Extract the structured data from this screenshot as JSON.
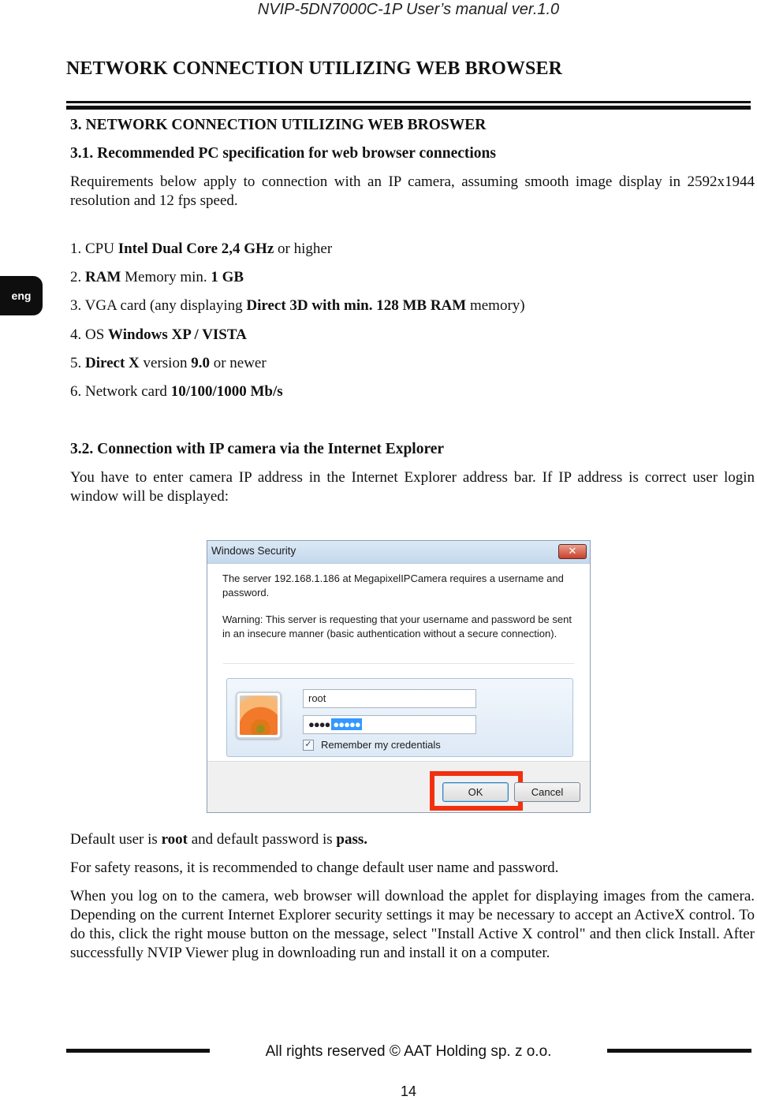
{
  "running_header": "NVIP-5DN7000C-1P User’s manual ver.1.0",
  "chapter_title": "NETWORK CONNECTION UTILIZING WEB BROWSER",
  "language_tab": "eng",
  "section3": {
    "heading": "3. NETWORK CONNECTION UTILIZING WEB BROSWER",
    "sub1": {
      "heading": "3.1. Recommended PC specification for web browser connections",
      "intro": "Requirements below apply to connection with an IP camera, assuming smooth image display in  2592x1944 resolution and 12 fps speed.",
      "requirements": [
        {
          "num": "1.",
          "parts": [
            {
              "t": " CPU ",
              "b": false
            },
            {
              "t": "Intel Dual Core 2,4 GHz",
              "b": true
            },
            {
              "t": " or higher",
              "b": false
            }
          ]
        },
        {
          "num": "2.",
          "parts": [
            {
              "t": " ",
              "b": false
            },
            {
              "t": "RAM",
              "b": true
            },
            {
              "t": " Memory min. ",
              "b": false
            },
            {
              "t": "1 GB",
              "b": true
            }
          ]
        },
        {
          "num": "3.",
          "parts": [
            {
              "t": " VGA card (any displaying ",
              "b": false
            },
            {
              "t": "Direct 3D with min. 128 MB RAM",
              "b": true
            },
            {
              "t": " memory)",
              "b": false
            }
          ]
        },
        {
          "num": "4.",
          "parts": [
            {
              "t": " OS ",
              "b": false
            },
            {
              "t": "Windows XP / VISTA",
              "b": true
            }
          ]
        },
        {
          "num": "5.",
          "parts": [
            {
              "t": " ",
              "b": false
            },
            {
              "t": "Direct X",
              "b": true
            },
            {
              "t": " version ",
              "b": false
            },
            {
              "t": "9.0",
              "b": true
            },
            {
              "t": " or newer",
              "b": false
            }
          ]
        },
        {
          "num": "6.",
          "parts": [
            {
              "t": " Network card ",
              "b": false
            },
            {
              "t": "10/100/1000 Mb/s",
              "b": true
            }
          ]
        }
      ]
    },
    "sub2": {
      "heading": "3.2. Connection with IP camera via the Internet Explorer",
      "intro": "You have to enter camera IP address in the Internet Explorer address bar. If IP address is correct user login window will be displayed:",
      "defaults": {
        "p1": "Default user is ",
        "user": "root",
        "p2": " and default password is ",
        "password": "pass."
      },
      "safety_note": "For safety reasons, it is recommended to change default user name and password.",
      "activex_note": "When you log on to the camera, web browser will download the applet for displaying images from the camera. Depending on the current Internet Explorer security settings it may be necessary to accept an ActiveX control. To do this, click the right mouse button on the message, select \"Install Active X control\" and then click Install. After successfully NVIP Viewer plug in downloading run and install it on a computer."
    }
  },
  "dialog": {
    "title": "Windows Security",
    "close_glyph": "✕",
    "message": "The server 192.168.1.186 at MegapixelIPCamera requires a username and password.",
    "warning": "Warning: This server is requesting that your username and password be sent in an insecure manner (basic authentication without a secure connection).",
    "username_value": "root",
    "password_masked": "●●●●",
    "password_selected": "●●●●●",
    "remember_label": "Remember my credentials",
    "remember_checked": true,
    "check_glyph": "✓",
    "ok_label": "OK",
    "cancel_label": "Cancel",
    "highlight_color": "#f2300f"
  },
  "footer": {
    "copyright": "All rights reserved © AAT Holding sp. z o.o.",
    "page_number": "14"
  }
}
